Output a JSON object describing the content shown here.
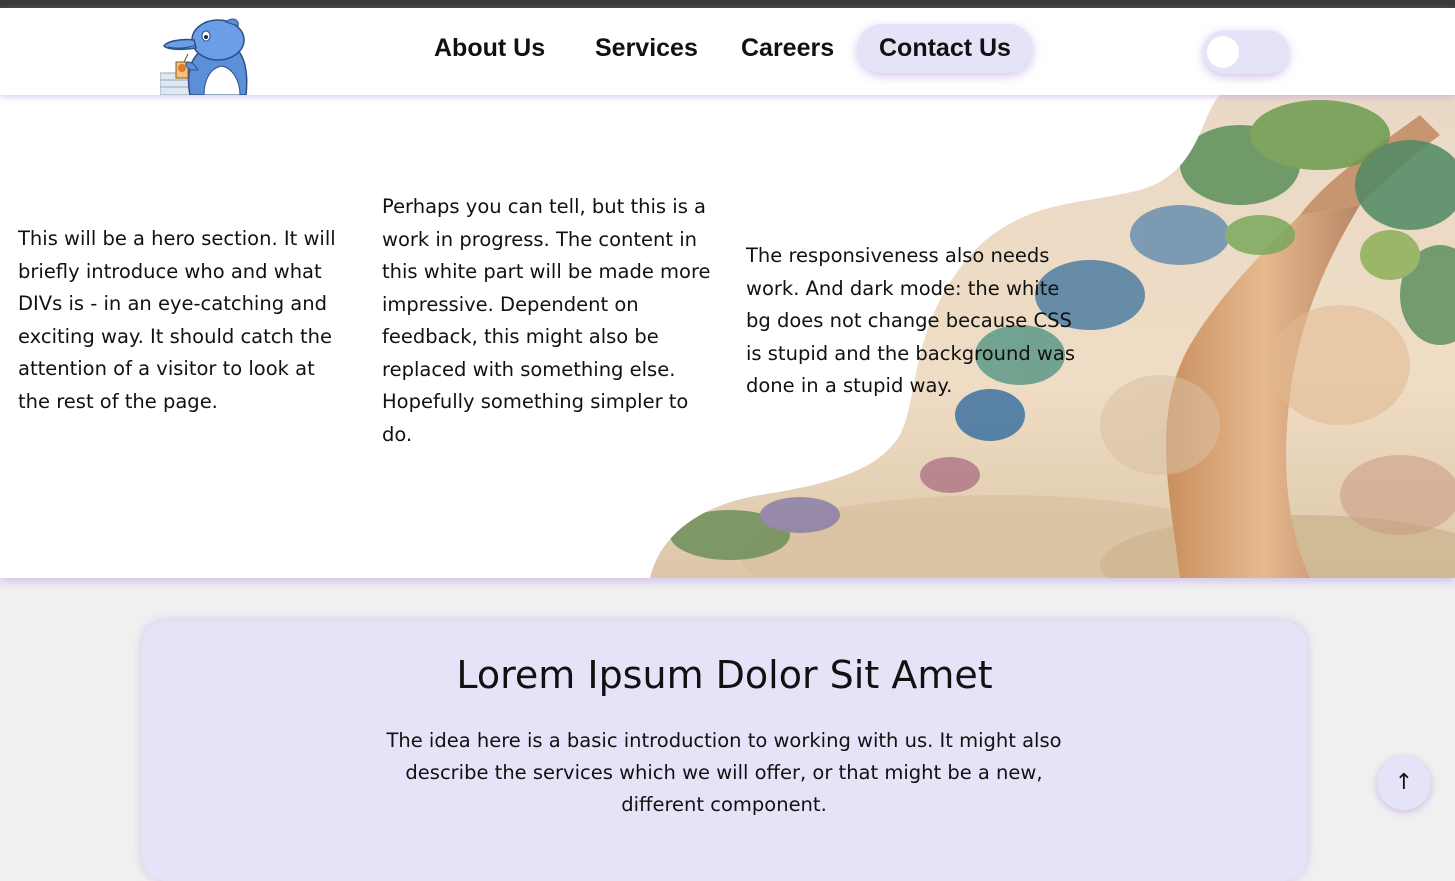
{
  "nav": {
    "items": [
      {
        "label": "About Us"
      },
      {
        "label": "Services"
      },
      {
        "label": "Careers"
      },
      {
        "label": "Contact Us",
        "active": true
      }
    ],
    "theme_toggle": {
      "state": "off"
    }
  },
  "hero": {
    "columns": [
      "This will be a hero section. It will briefly introduce who and what DIVs is - in an eye-catching and exciting way. It should catch the attention of a visitor to look at the rest of the page.",
      "Perhaps you can tell, but this is a work in progress. The content in this white part will be made more impressive. Dependent on feedback, this might also be replaced with something else. Hopefully something simpler to do.",
      "The responsiveness also needs work. And dark mode: the white bg does not change because CSS is stupid and the background was done in a stupid way."
    ]
  },
  "intro": {
    "title": "Lorem Ipsum Dolor Sit Amet",
    "body": "The idea here is a basic introduction to working with us. It might also describe the services which we will offer, or that might be a new, different component."
  },
  "scroll_top": {
    "label": "↑"
  },
  "colors": {
    "accent_lavender": "#e5e3f8",
    "shadow_purple": "#c8a8ec",
    "top_strip": "#3a3a3a",
    "page_bg": "#f0f0f0"
  },
  "icons": {
    "logo": "dolphin-mascot-logo",
    "scroll_top": "arrow-up-icon"
  }
}
